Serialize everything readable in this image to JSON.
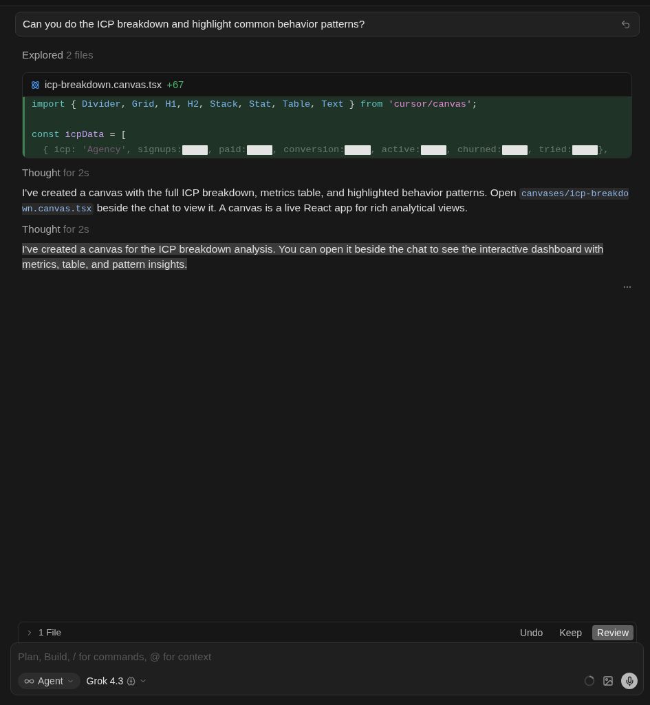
{
  "query": {
    "text": "Can you do the ICP breakdown and highlight common behavior patterns?"
  },
  "explored": {
    "label": "Explored",
    "count": "2 files"
  },
  "code_card": {
    "filename": "icp-breakdown.canvas.tsx",
    "added": "+67",
    "lines": [
      {
        "kind": "code",
        "tokens": [
          {
            "kind": "keyword",
            "text": "import"
          },
          {
            "kind": "punct",
            "text": " { "
          },
          {
            "kind": "type",
            "text": "Divider"
          },
          {
            "kind": "punct",
            "text": ", "
          },
          {
            "kind": "type",
            "text": "Grid"
          },
          {
            "kind": "punct",
            "text": ", "
          },
          {
            "kind": "type",
            "text": "H1"
          },
          {
            "kind": "punct",
            "text": ", "
          },
          {
            "kind": "type",
            "text": "H2"
          },
          {
            "kind": "punct",
            "text": ", "
          },
          {
            "kind": "type",
            "text": "Stack"
          },
          {
            "kind": "punct",
            "text": ", "
          },
          {
            "kind": "type",
            "text": "Stat"
          },
          {
            "kind": "punct",
            "text": ", "
          },
          {
            "kind": "type",
            "text": "Table"
          },
          {
            "kind": "punct",
            "text": ", "
          },
          {
            "kind": "type",
            "text": "Text"
          },
          {
            "kind": "punct",
            "text": " } "
          },
          {
            "kind": "keyword",
            "text": "from"
          },
          {
            "kind": "string",
            "text": " 'cursor/canvas'"
          },
          {
            "kind": "punct",
            "text": ";"
          }
        ]
      },
      {
        "kind": "blank"
      },
      {
        "kind": "code",
        "tokens": [
          {
            "kind": "keyword",
            "text": "const"
          },
          {
            "kind": "variable",
            "text": " icpData"
          },
          {
            "kind": "punct",
            "text": " = ["
          }
        ]
      },
      {
        "kind": "code",
        "tokens": [
          {
            "kind": "punct",
            "text": "  { icp: "
          },
          {
            "kind": "string",
            "text": "'Agency'"
          },
          {
            "kind": "punct",
            "text": ", signups:"
          },
          {
            "kind": "redacted"
          },
          {
            "kind": "punct",
            "text": ", paid:"
          },
          {
            "kind": "redacted"
          },
          {
            "kind": "punct",
            "text": ", conversion:"
          },
          {
            "kind": "redacted"
          },
          {
            "kind": "punct",
            "text": ", active:"
          },
          {
            "kind": "redacted"
          },
          {
            "kind": "punct",
            "text": ", churned:"
          },
          {
            "kind": "redacted"
          },
          {
            "kind": "punct",
            "text": ", tried:"
          },
          {
            "kind": "redacted"
          },
          {
            "kind": "punct",
            "text": "},"
          }
        ]
      }
    ]
  },
  "messages": [
    {
      "kind": "thought",
      "label": "Thought",
      "duration": "for 2s",
      "selected": false
    },
    {
      "kind": "paragraph",
      "selected": false,
      "segments": [
        {
          "kind": "text",
          "text": "I've created a canvas with the full ICP breakdown, metrics table, and highlighted behavior patterns. Open "
        },
        {
          "kind": "code",
          "text": "canvases/icp-breakdown.canvas.tsx"
        },
        {
          "kind": "text",
          "text": " beside the chat to view it. A canvas is a live React app for rich analytical views."
        }
      ]
    },
    {
      "kind": "thought",
      "label": "Thought",
      "duration": "for 2s",
      "selected": false
    },
    {
      "kind": "paragraph",
      "selected": true,
      "segments": [
        {
          "kind": "text",
          "text": "I've created a canvas for the ICP breakdown analysis. You can open it beside the chat to see the interactive dashboard with metrics, table, and pattern insights."
        }
      ]
    }
  ],
  "changes_bar": {
    "summary": "1 File",
    "expanded": false,
    "actions": [
      {
        "label": "Undo",
        "primary": false
      },
      {
        "label": "Keep",
        "primary": false
      },
      {
        "label": "Review",
        "primary": true
      }
    ]
  },
  "composer": {
    "placeholder": "Plan, Build, / for commands, @ for context",
    "mode": "Agent",
    "model": "Grok 4.3"
  }
}
